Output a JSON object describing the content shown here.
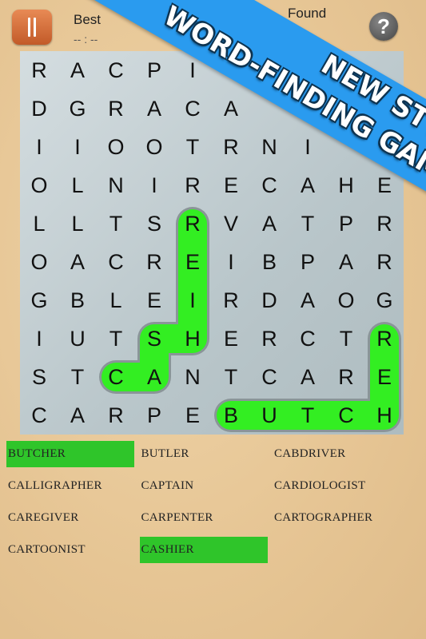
{
  "header": {
    "pause_icon": "pause-icon",
    "best_label": "Best",
    "best_time": "-- : --",
    "found_label": "Found",
    "help_icon": "question-mark-icon"
  },
  "banner": {
    "line1": "NEW STYLE",
    "line2": "WORD-FINDING GAME",
    "color": "#2a9bef"
  },
  "grid": {
    "rows": [
      [
        "R",
        "A",
        "C",
        "P",
        "I",
        "",
        "",
        "",
        "",
        ""
      ],
      [
        "D",
        "G",
        "R",
        "A",
        "C",
        "A",
        "",
        "",
        "",
        ""
      ],
      [
        "I",
        "I",
        "O",
        "O",
        "T",
        "R",
        "N",
        "I",
        "",
        ""
      ],
      [
        "O",
        "L",
        "N",
        "I",
        "R",
        "E",
        "C",
        "A",
        "H",
        "E"
      ],
      [
        "L",
        "L",
        "T",
        "S",
        "R",
        "V",
        "A",
        "T",
        "P",
        "R"
      ],
      [
        "O",
        "A",
        "C",
        "R",
        "E",
        "I",
        "B",
        "P",
        "A",
        "R"
      ],
      [
        "G",
        "B",
        "L",
        "E",
        "I",
        "R",
        "D",
        "A",
        "O",
        "G"
      ],
      [
        "I",
        "U",
        "T",
        "S",
        "H",
        "E",
        "R",
        "C",
        "T",
        "R"
      ],
      [
        "S",
        "T",
        "C",
        "A",
        "N",
        "T",
        "C",
        "A",
        "R",
        "E"
      ],
      [
        "C",
        "A",
        "R",
        "P",
        "E",
        "B",
        "U",
        "T",
        "C",
        "H"
      ]
    ],
    "highlight_color": "#33ee22",
    "found_paths": [
      {
        "word": "CASHIER",
        "cells": [
          [
            8,
            2
          ],
          [
            8,
            3
          ],
          [
            7,
            3
          ],
          [
            7,
            4
          ],
          [
            6,
            4
          ],
          [
            5,
            4
          ],
          [
            4,
            4
          ]
        ]
      },
      {
        "word": "BUTCHER",
        "cells": [
          [
            9,
            5
          ],
          [
            9,
            6
          ],
          [
            9,
            7
          ],
          [
            9,
            8
          ],
          [
            9,
            9
          ],
          [
            8,
            9
          ],
          [
            7,
            9
          ]
        ]
      }
    ]
  },
  "words": [
    {
      "label": "BUTCHER",
      "found": true
    },
    {
      "label": "BUTLER",
      "found": false
    },
    {
      "label": "CABDRIVER",
      "found": false
    },
    {
      "label": "CALLIGRAPHER",
      "found": false
    },
    {
      "label": "CAPTAIN",
      "found": false
    },
    {
      "label": "CARDIOLOGIST",
      "found": false
    },
    {
      "label": "CAREGIVER",
      "found": false
    },
    {
      "label": "CARPENTER",
      "found": false
    },
    {
      "label": "CARTOGRAPHER",
      "found": false
    },
    {
      "label": "CARTOONIST",
      "found": false
    },
    {
      "label": "CASHIER",
      "found": true
    }
  ]
}
